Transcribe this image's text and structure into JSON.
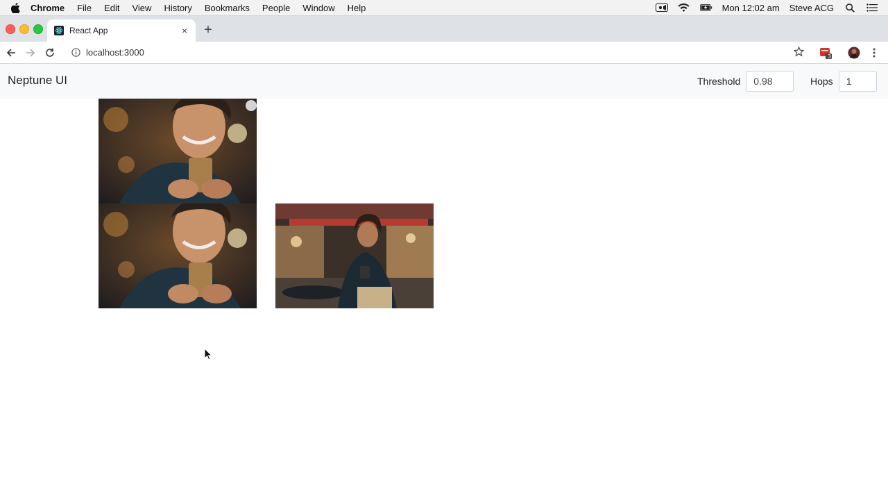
{
  "menubar": {
    "app_name": "Chrome",
    "items": [
      "File",
      "Edit",
      "View",
      "History",
      "Bookmarks",
      "People",
      "Window",
      "Help"
    ],
    "clock": "Mon 12:02 am",
    "user": "Steve ACG"
  },
  "browser": {
    "tab_title": "React App",
    "new_tab_symbol": "+",
    "close_tab_symbol": "×",
    "url": "localhost:3000",
    "extension_badge": "3"
  },
  "app": {
    "brand": "Neptune UI",
    "threshold": {
      "label": "Threshold",
      "value": "0.98"
    },
    "hops": {
      "label": "Hops",
      "value": "1"
    }
  },
  "images": [
    {
      "name": "man-smiling-at-phone-closeup-1"
    },
    {
      "name": "man-smiling-at-phone-closeup-2"
    },
    {
      "name": "man-in-cafe-with-phone"
    }
  ],
  "colors": {
    "tabstrip": "#dee1e6",
    "appnav_bg": "#f8f9fa",
    "input_border": "#ced4da"
  }
}
